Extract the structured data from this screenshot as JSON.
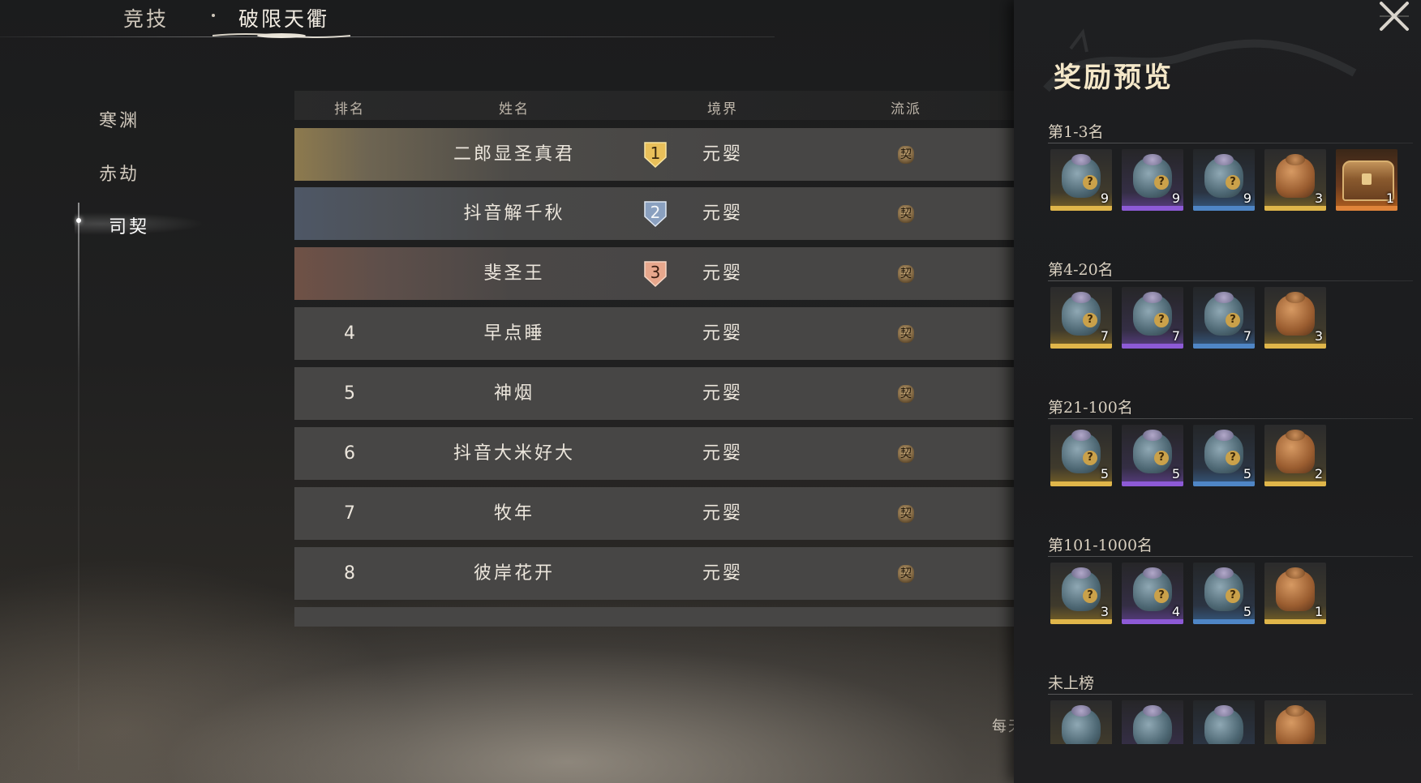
{
  "topnav": {
    "compete_label": "竞技",
    "active_label": "破限天衢"
  },
  "sidebar": {
    "tabs": [
      "寒渊",
      "赤劫",
      "司契"
    ],
    "active_index": 2
  },
  "table": {
    "headers": {
      "rank": "排名",
      "name": "姓名",
      "realm": "境界",
      "school": "流派"
    },
    "rows": [
      {
        "rank": "1",
        "name": "二郎显圣真君",
        "realm": "元婴",
        "school_icon": "契"
      },
      {
        "rank": "2",
        "name": "抖音解千秋",
        "realm": "元婴",
        "school_icon": "契"
      },
      {
        "rank": "3",
        "name": "斐圣王",
        "realm": "元婴",
        "school_icon": "契"
      },
      {
        "rank": "4",
        "name": "早点睡",
        "realm": "元婴",
        "school_icon": "契"
      },
      {
        "rank": "5",
        "name": "神烟",
        "realm": "元婴",
        "school_icon": "契"
      },
      {
        "rank": "6",
        "name": "抖音大米好大",
        "realm": "元婴",
        "school_icon": "契"
      },
      {
        "rank": "7",
        "name": "牧年",
        "realm": "元婴",
        "school_icon": "契"
      },
      {
        "rank": "8",
        "name": "彼岸花开",
        "realm": "元婴",
        "school_icon": "契"
      }
    ]
  },
  "rewards": {
    "title": "奖励预览",
    "tiers": [
      {
        "label": "第1-3名",
        "items": [
          {
            "kind": "blue-bag",
            "rarity": "gold",
            "count": "9"
          },
          {
            "kind": "blue-bag",
            "rarity": "purple",
            "count": "9"
          },
          {
            "kind": "blue-bag",
            "rarity": "blue",
            "count": "9"
          },
          {
            "kind": "brown-bag",
            "rarity": "gold",
            "count": "3"
          },
          {
            "kind": "chest",
            "rarity": "orange",
            "count": "1"
          }
        ]
      },
      {
        "label": "第4-20名",
        "items": [
          {
            "kind": "blue-bag",
            "rarity": "gold",
            "count": "7"
          },
          {
            "kind": "blue-bag",
            "rarity": "purple",
            "count": "7"
          },
          {
            "kind": "blue-bag",
            "rarity": "blue",
            "count": "7"
          },
          {
            "kind": "brown-bag",
            "rarity": "gold",
            "count": "3"
          }
        ]
      },
      {
        "label": "第21-100名",
        "items": [
          {
            "kind": "blue-bag",
            "rarity": "gold",
            "count": "5"
          },
          {
            "kind": "blue-bag",
            "rarity": "purple",
            "count": "5"
          },
          {
            "kind": "blue-bag",
            "rarity": "blue",
            "count": "5"
          },
          {
            "kind": "brown-bag",
            "rarity": "gold",
            "count": "2"
          }
        ]
      },
      {
        "label": "第101-1000名",
        "items": [
          {
            "kind": "blue-bag",
            "rarity": "gold",
            "count": "3"
          },
          {
            "kind": "blue-bag",
            "rarity": "purple",
            "count": "4"
          },
          {
            "kind": "blue-bag",
            "rarity": "blue",
            "count": "5"
          },
          {
            "kind": "brown-bag",
            "rarity": "gold",
            "count": "1"
          }
        ]
      },
      {
        "label": "未上榜",
        "items": [
          {
            "kind": "blue-bag",
            "rarity": "gold",
            "count": ""
          },
          {
            "kind": "blue-bag",
            "rarity": "purple",
            "count": ""
          },
          {
            "kind": "blue-bag",
            "rarity": "blue",
            "count": ""
          },
          {
            "kind": "brown-bag",
            "rarity": "gold",
            "count": ""
          }
        ]
      }
    ]
  },
  "footer": {
    "hint_partial": "每天"
  },
  "icons": {
    "close": "close-icon",
    "bag_question": "question-icon"
  }
}
